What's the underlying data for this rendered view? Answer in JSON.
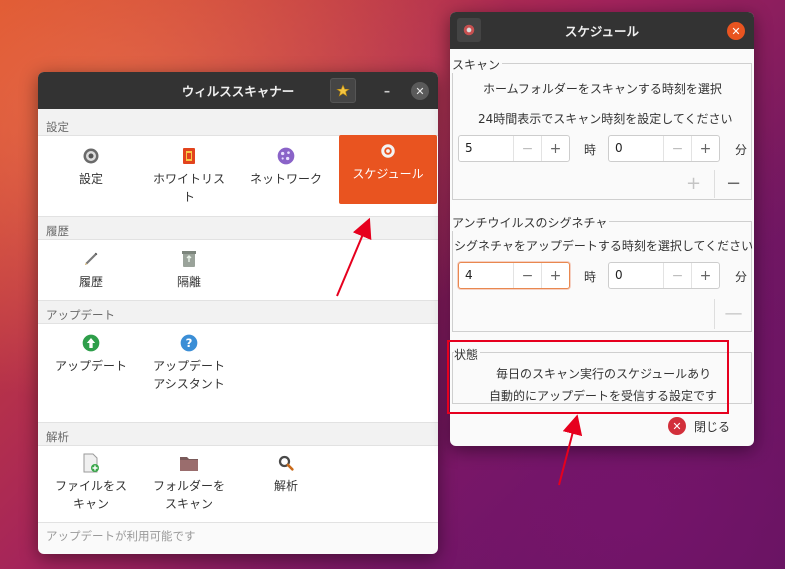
{
  "main_window": {
    "title": "ウィルススキャナー",
    "minimize_glyph": "–",
    "close_glyph": "✕",
    "sections": {
      "settings": {
        "header": "設定",
        "items": [
          {
            "label": "設定",
            "icon": "gear-icon"
          },
          {
            "label": "ホワイトリスト",
            "icon": "whitelist-icon"
          },
          {
            "label": "ネットワーク",
            "icon": "network-icon"
          },
          {
            "label": "スケジュール",
            "icon": "schedule-gear-icon",
            "active": true
          }
        ]
      },
      "history": {
        "header": "履歴",
        "items": [
          {
            "label": "履歴",
            "icon": "pencil-icon"
          },
          {
            "label": "隔離",
            "icon": "recycle-bin-icon"
          }
        ]
      },
      "update": {
        "header": "アップデート",
        "items": [
          {
            "label": "アップデート",
            "icon": "update-arrow-icon"
          },
          {
            "label": "アップデートアシスタント",
            "icon": "help-icon"
          }
        ]
      },
      "analysis": {
        "header": "解析",
        "items": [
          {
            "label": "ファイルをスキャン",
            "icon": "file-add-icon"
          },
          {
            "label": "フォルダーをスキャン",
            "icon": "folder-icon"
          },
          {
            "label": "解析",
            "icon": "magnifier-icon"
          }
        ]
      }
    },
    "status": "アップデートが利用可能です"
  },
  "schedule_window": {
    "title": "スケジュール",
    "close_glyph": "✕",
    "scan": {
      "label": "スキャン",
      "line1": "ホームフォルダーをスキャンする時刻を選択",
      "line2": "24時間表示でスキャン時刻を設定してください",
      "hour_value": "5",
      "minute_value": "0",
      "hour_unit": "時",
      "minute_unit": "分",
      "add_glyph": "+",
      "remove_glyph": "−"
    },
    "signature": {
      "label": "アンチウイルスのシグネチャ",
      "line1": "シグネチャをアップデートする時刻を選択してください",
      "hour_value": "4",
      "minute_value": "0",
      "hour_unit": "時",
      "minute_unit": "分",
      "remove_glyph": "—"
    },
    "status": {
      "label": "状態",
      "line1": "毎日のスキャン実行のスケジュールあり",
      "line2": "自動的にアップデートを受信する設定です"
    },
    "close_label": "閉じる",
    "spin_minus": "−",
    "spin_plus": "+"
  },
  "colors": {
    "accent": "#e95420",
    "highlight": "#e6001e",
    "titlebar": "#333333"
  }
}
